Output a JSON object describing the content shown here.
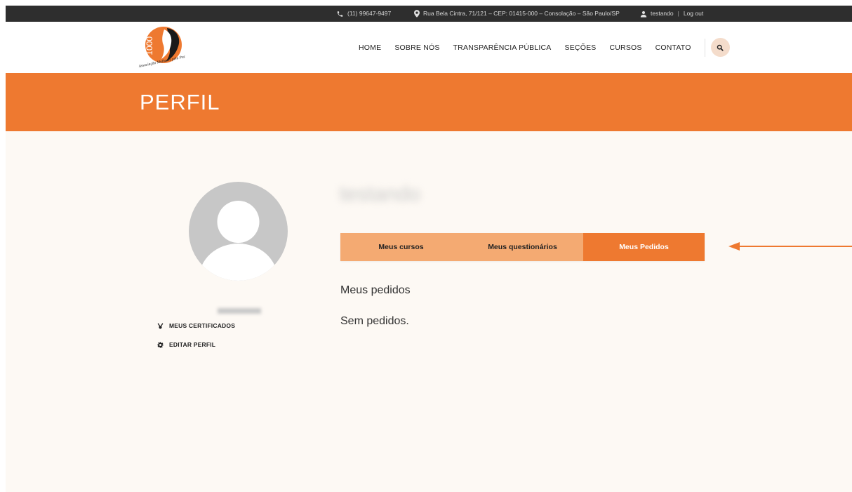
{
  "topbar": {
    "phone": "(11) 99647-9497",
    "address": "Rua Bela Cintra, 71/121 – CEP: 01415-000 – Consolação – São Paulo/SP",
    "username": "testando",
    "separator": "|",
    "logout": "Log out"
  },
  "header": {
    "logo_text": "1000",
    "logo_caption": "Associação Mulheres pela Paz",
    "nav": [
      {
        "label": "HOME"
      },
      {
        "label": "SOBRE NÓS"
      },
      {
        "label": "TRANSPARÊNCIA PÚBLICA"
      },
      {
        "label": "SEÇÕES"
      },
      {
        "label": "CURSOS"
      },
      {
        "label": "CONTATO"
      }
    ]
  },
  "banner": {
    "title": "PERFIL"
  },
  "sidebar": {
    "username_blurred": "testando",
    "links": [
      {
        "label": "MEUS CERTIFICADOS",
        "icon": "medal-icon"
      },
      {
        "label": "EDITAR PERFIL",
        "icon": "gear-icon"
      }
    ]
  },
  "profile": {
    "name_blurred": "testando",
    "tabs": [
      {
        "label": "Meus cursos",
        "active": false
      },
      {
        "label": "Meus questionários",
        "active": false
      },
      {
        "label": "Meus Pedidos",
        "active": true
      }
    ],
    "section_title": "Meus pedidos",
    "empty_message": "Sem pedidos."
  },
  "colors": {
    "accent": "#ee7930",
    "tab_inactive": "#f4aa72",
    "topbar": "#2e2e2e",
    "page_bg": "#fdf9f4",
    "search_bg": "#f4dccb"
  }
}
